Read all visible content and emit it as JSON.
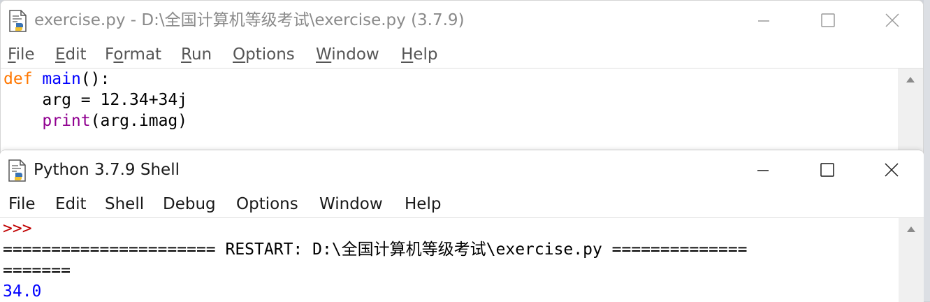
{
  "editor": {
    "title": "exercise.py - D:\\全国计算机等级考试\\exercise.py (3.7.9)",
    "menu": [
      {
        "label": "File",
        "underline": "F",
        "rest": "ile"
      },
      {
        "label": "Edit",
        "underline": "E",
        "rest": "dit"
      },
      {
        "label": "Format",
        "pre": "F",
        "underline": "o",
        "rest": "rmat"
      },
      {
        "label": "Run",
        "underline": "R",
        "rest": "un"
      },
      {
        "label": "Options",
        "underline": "O",
        "rest": "ptions"
      },
      {
        "label": "Window",
        "underline": "W",
        "rest": "indow"
      },
      {
        "label": "Help",
        "underline": "H",
        "rest": "elp"
      }
    ],
    "code": {
      "line1_kw": "def",
      "line1_name": "main",
      "line1_rest": "():",
      "line2": "    arg = 12.34+34j",
      "line3_indent": "    ",
      "line3_builtin": "print",
      "line3_rest": "(arg.imag)"
    }
  },
  "shell": {
    "title": "Python 3.7.9 Shell",
    "menu": [
      "File",
      "Edit",
      "Shell",
      "Debug",
      "Options",
      "Window",
      "Help"
    ],
    "lines": {
      "prompt": ">>>",
      "restart": "====================== RESTART: D:\\全国计算机等级考试\\exercise.py ==============",
      "restart_cont": "=======",
      "output": "34.0"
    }
  },
  "icons": {
    "app": "python-idle-icon",
    "minimize": "minimize-icon",
    "maximize": "maximize-icon",
    "close": "close-icon",
    "scroll_up": "scroll-up-arrow-icon"
  },
  "colors": {
    "keyword": "#ff7700",
    "definition": "#0000ff",
    "builtin": "#900090",
    "prompt": "#c00000",
    "stdout": "#0000ff"
  }
}
